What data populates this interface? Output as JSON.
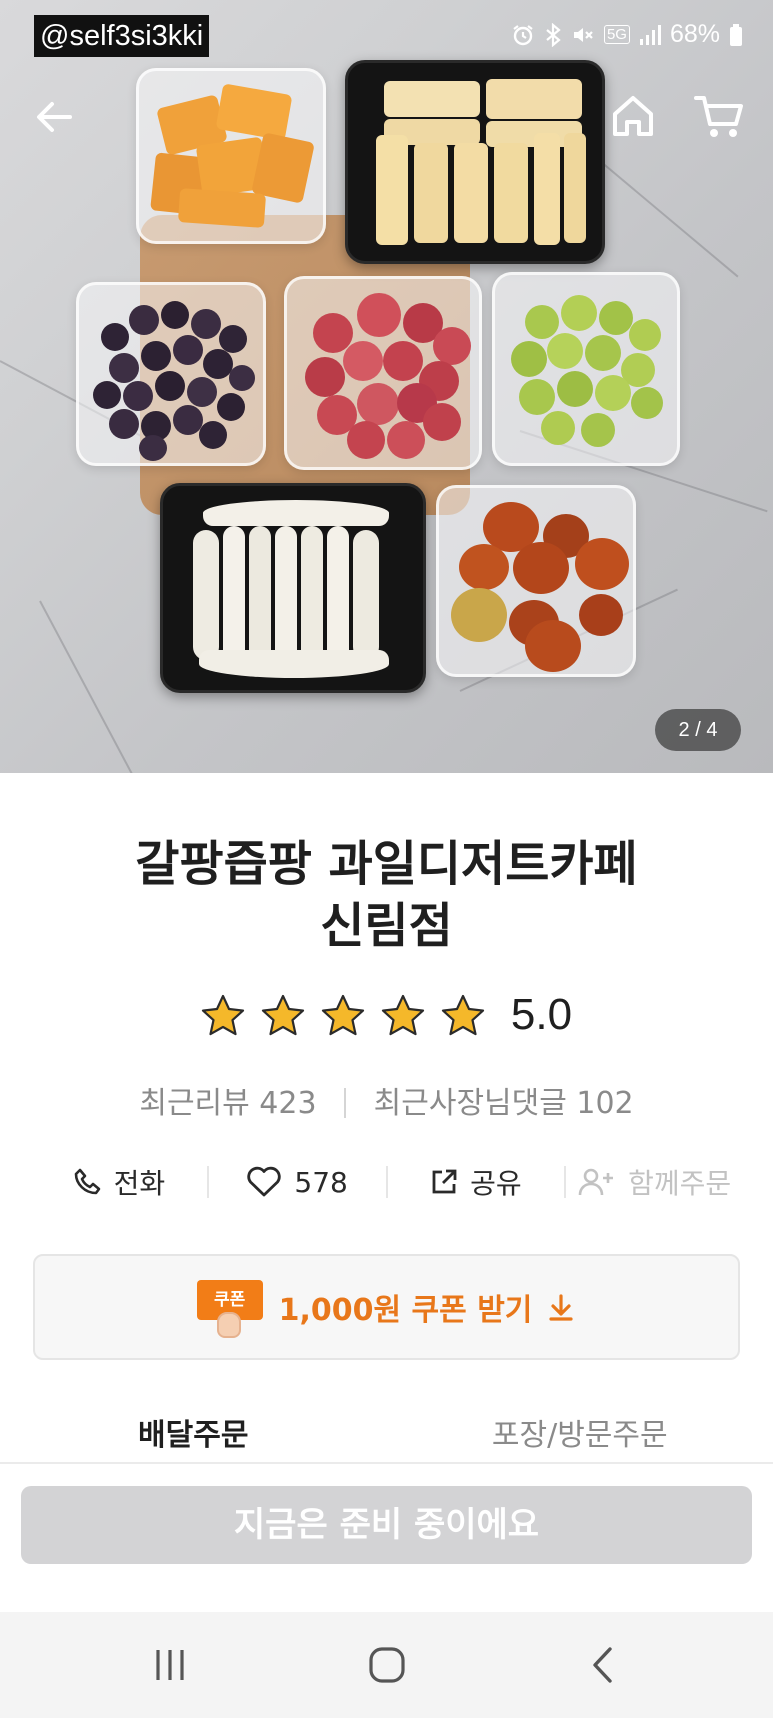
{
  "status_bar": {
    "handle": "@self3si3kki",
    "network": "5G",
    "battery": "68%",
    "icons": [
      "alarm-icon",
      "bluetooth-icon",
      "mute-icon",
      "5g-icon",
      "signal-icon",
      "battery-icon"
    ]
  },
  "gallery": {
    "counter": "2 / 4",
    "nav_icons": [
      "back-arrow-icon",
      "home-icon",
      "cart-icon"
    ]
  },
  "store": {
    "name_line1": "갈팡즙팡 과일디저트카페",
    "name_line2": "신림점",
    "rating": "5.0",
    "stars_filled": 5,
    "stars_total": 5,
    "recent_reviews": "최근리뷰 423",
    "owner_replies": "최근사장님댓글 102"
  },
  "actions": {
    "call": "전화",
    "likes": "578",
    "share": "공유",
    "group_order": "함께주문"
  },
  "coupon": {
    "badge": "쿠폰",
    "label": "1,000원 쿠폰 받기"
  },
  "tabs": {
    "delivery": "배달주문",
    "pickup": "포장/방문주문",
    "active": "delivery"
  },
  "cta": {
    "label": "지금은 준비 중이에요"
  },
  "colors": {
    "accent": "#e8771a",
    "star": "#f5b82a",
    "cta_disabled": "#d3d3d5"
  }
}
